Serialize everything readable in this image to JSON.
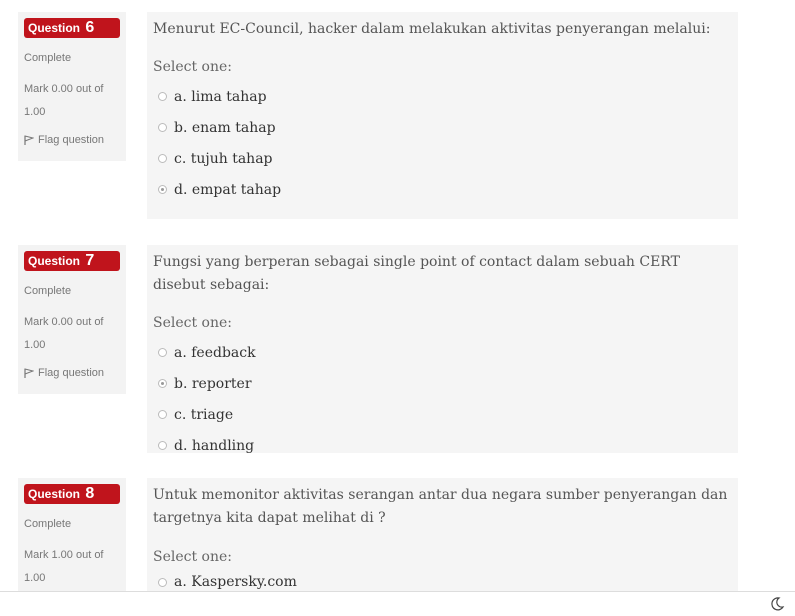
{
  "questions": [
    {
      "label": "Question",
      "number": "6",
      "state": "Complete",
      "grade": "Mark 0.00 out of 1.00",
      "flag": "Flag question",
      "text": "Menurut EC-Council, hacker dalam melakukan aktivitas penyerangan melalui:",
      "prompt": "Select one:",
      "options": [
        {
          "label": "a. lima tahap",
          "checked": false
        },
        {
          "label": "b. enam tahap",
          "checked": false
        },
        {
          "label": "c. tujuh tahap",
          "checked": false
        },
        {
          "label": "d. empat tahap",
          "checked": true
        }
      ]
    },
    {
      "label": "Question",
      "number": "7",
      "state": "Complete",
      "grade": "Mark 0.00 out of 1.00",
      "flag": "Flag question",
      "text": "Fungsi yang berperan sebagai single point of contact dalam sebuah CERT disebut sebagai:",
      "prompt": "Select one:",
      "options": [
        {
          "label": "a. feedback",
          "checked": false
        },
        {
          "label": "b. reporter",
          "checked": true
        },
        {
          "label": "c. triage",
          "checked": false
        },
        {
          "label": "d. handling",
          "checked": false
        }
      ]
    },
    {
      "label": "Question",
      "number": "8",
      "state": "Complete",
      "grade": "Mark 1.00 out of 1.00",
      "flag": "Flag question",
      "text": "Untuk memonitor aktivitas serangan antar dua negara sumber penyerangan dan targetnya kita dapat melihat di ?",
      "prompt": "Select one:",
      "options": [
        {
          "label": "a. Kaspersky.com",
          "checked": false
        }
      ]
    }
  ],
  "icons": {
    "flag": "flag-icon",
    "theme": "moon-icon"
  },
  "colors": {
    "question_badge": "#c0141c"
  }
}
